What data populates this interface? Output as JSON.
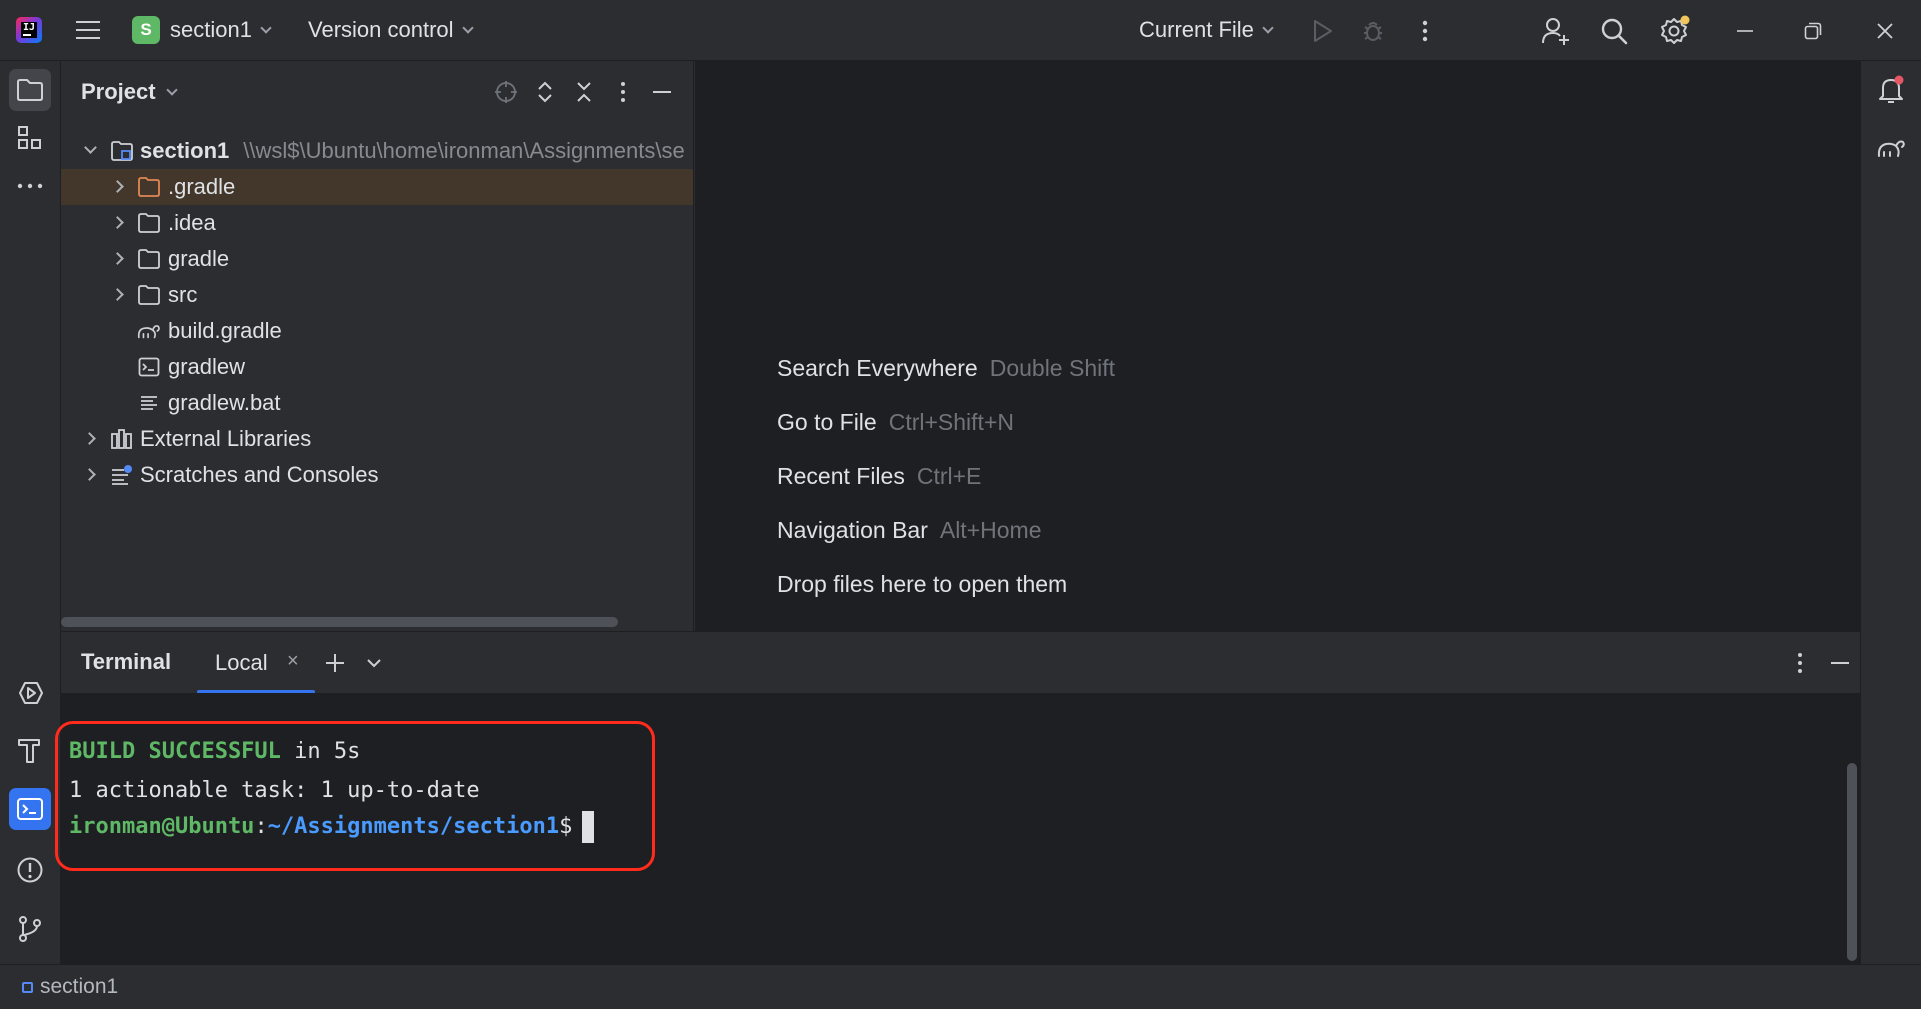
{
  "topbar": {
    "project_badge": "S",
    "project_name": "section1",
    "vcs_label": "Version control",
    "run_config": "Current File"
  },
  "project": {
    "title": "Project",
    "tree": [
      {
        "label": "section1",
        "path": "\\\\wsl$\\Ubuntu\\home\\ironman\\Assignments\\se",
        "bold": true
      },
      {
        "label": ".gradle"
      },
      {
        "label": ".idea"
      },
      {
        "label": "gradle"
      },
      {
        "label": "src"
      },
      {
        "label": "build.gradle"
      },
      {
        "label": "gradlew"
      },
      {
        "label": "gradlew.bat"
      },
      {
        "label": "External Libraries"
      },
      {
        "label": "Scratches and Consoles"
      }
    ]
  },
  "editor_hints": [
    {
      "action": "Search Everywhere",
      "shortcut": "Double Shift"
    },
    {
      "action": "Go to File",
      "shortcut": "Ctrl+Shift+N"
    },
    {
      "action": "Recent Files",
      "shortcut": "Ctrl+E"
    },
    {
      "action": "Navigation Bar",
      "shortcut": "Alt+Home"
    },
    {
      "action": "Drop files here to open them",
      "shortcut": ""
    }
  ],
  "terminal": {
    "title": "Terminal",
    "tab_label": "Local",
    "lines": {
      "build_status": "BUILD SUCCESSFUL",
      "build_time": " in 5s",
      "tasks": "1 actionable task: 1 up-to-date",
      "prompt_user": "ironman@Ubuntu",
      "prompt_sep": ":",
      "prompt_path": "~/Assignments/section1",
      "prompt_symbol": "$"
    }
  },
  "status_bar": {
    "project": "section1"
  },
  "colors": {
    "background": "#2b2d30",
    "editor_bg": "#1e1f22",
    "accent": "#3574f0",
    "success_green": "#5fb865",
    "path_blue": "#4a9bff",
    "highlight_red": "#ff2b1c",
    "gradle_folder": "#e08855"
  }
}
